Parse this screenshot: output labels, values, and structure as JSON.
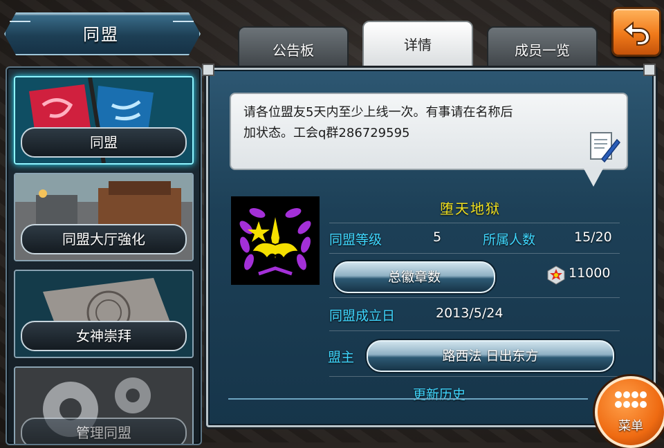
{
  "header": {
    "title": "同盟"
  },
  "sidebar": {
    "items": [
      {
        "label": "同盟"
      },
      {
        "label": "同盟大厅強化"
      },
      {
        "label": "女神崇拜"
      },
      {
        "label": "管理同盟"
      }
    ]
  },
  "tabs": [
    {
      "label": "公告板"
    },
    {
      "label": "详情"
    },
    {
      "label": "成员一览"
    }
  ],
  "notice": {
    "text_line1": "请各位盟友5天内至少上线一次。有事请在名称后",
    "text_line2": "加状态。工会q群286729595"
  },
  "guild": {
    "name": "堕天地狱",
    "level_label": "同盟等级",
    "level": "5",
    "members_label": "所属人数",
    "members": "15/20",
    "badges_label": "总徽章数",
    "badges": "11000",
    "founded_label": "同盟成立日",
    "founded": "2013/5/24",
    "leader_label": "盟主",
    "leader": "路西法 日出东方",
    "history_label": "更新历史"
  },
  "menu": {
    "label": "菜单"
  },
  "colors": {
    "accent": "#3fd7ff",
    "guild_name": "#f0e020",
    "menu": "#ef6b12"
  }
}
